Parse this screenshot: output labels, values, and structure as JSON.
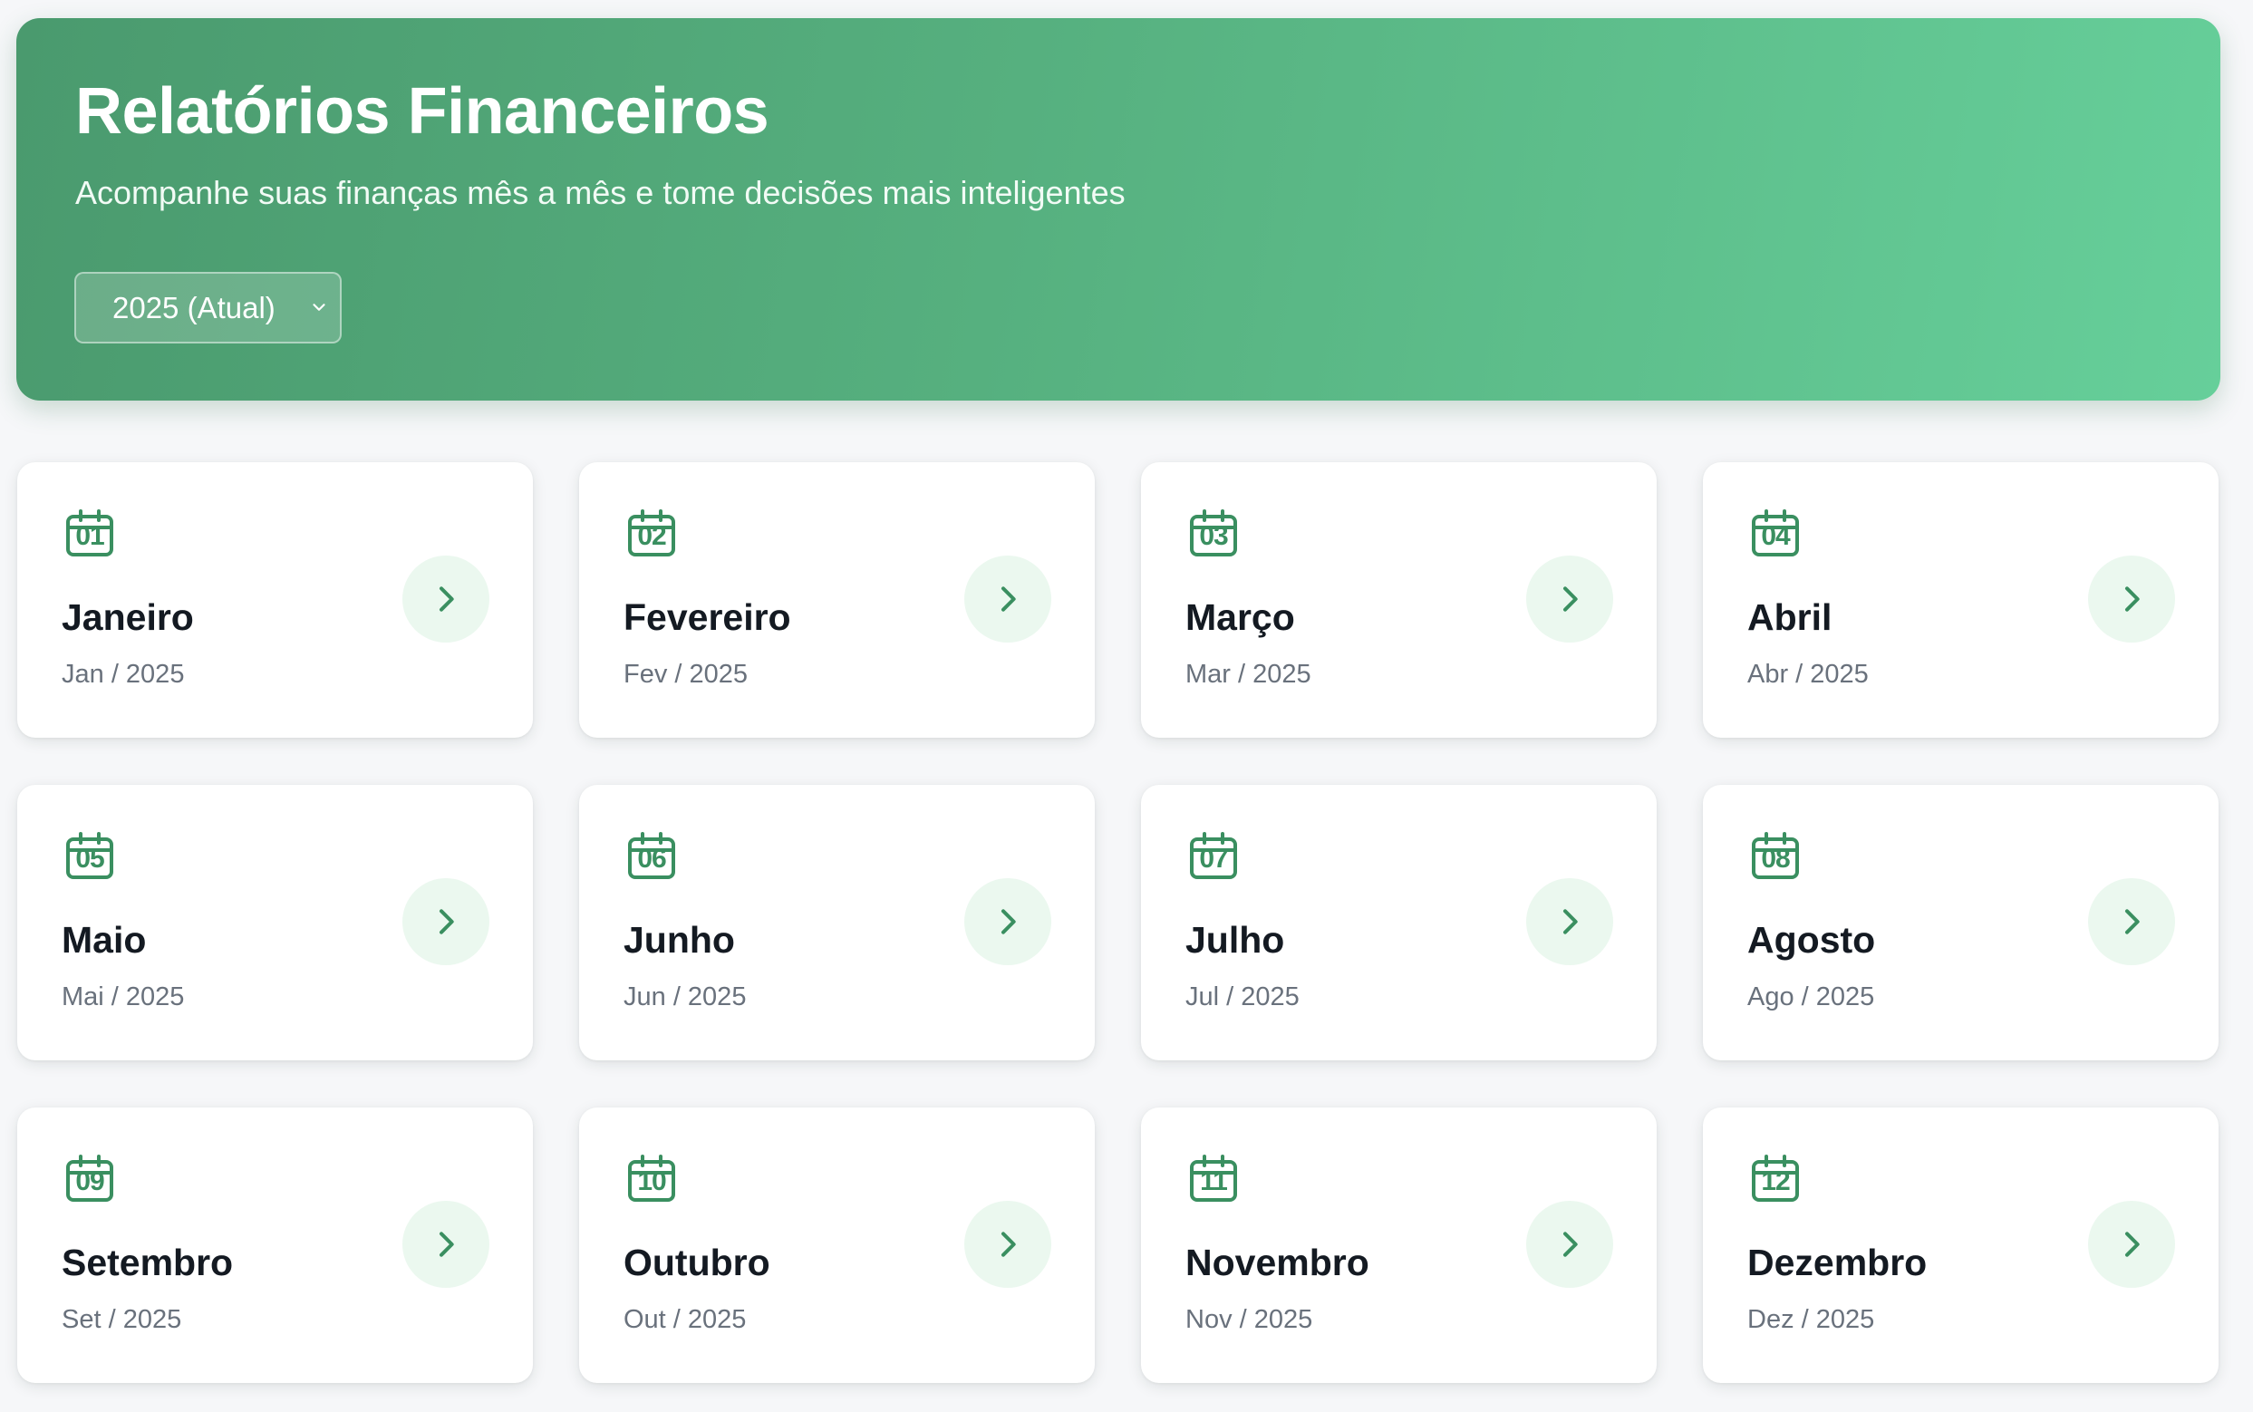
{
  "header": {
    "title": "Relatórios Financeiros",
    "subtitle": "Acompanhe suas finanças mês a mês e tome decisões mais inteligentes",
    "year_select": {
      "value": "2025 (Atual)"
    }
  },
  "colors": {
    "accent": "#3a8f60",
    "hero_gradient_start": "#4a9a6e",
    "hero_gradient_end": "#66cf9a",
    "chevron_bg": "#ebf8ef"
  },
  "icons": {
    "month_icon": "calendar-icon",
    "open_icon": "chevron-right-icon",
    "select_icon": "chevron-down-icon"
  },
  "months": [
    {
      "number": "01",
      "name": "Janeiro",
      "label": "Jan / 2025"
    },
    {
      "number": "02",
      "name": "Fevereiro",
      "label": "Fev / 2025"
    },
    {
      "number": "03",
      "name": "Março",
      "label": "Mar / 2025"
    },
    {
      "number": "04",
      "name": "Abril",
      "label": "Abr / 2025"
    },
    {
      "number": "05",
      "name": "Maio",
      "label": "Mai / 2025"
    },
    {
      "number": "06",
      "name": "Junho",
      "label": "Jun / 2025"
    },
    {
      "number": "07",
      "name": "Julho",
      "label": "Jul / 2025"
    },
    {
      "number": "08",
      "name": "Agosto",
      "label": "Ago / 2025"
    },
    {
      "number": "09",
      "name": "Setembro",
      "label": "Set / 2025"
    },
    {
      "number": "10",
      "name": "Outubro",
      "label": "Out / 2025"
    },
    {
      "number": "11",
      "name": "Novembro",
      "label": "Nov / 2025"
    },
    {
      "number": "12",
      "name": "Dezembro",
      "label": "Dez / 2025"
    }
  ]
}
